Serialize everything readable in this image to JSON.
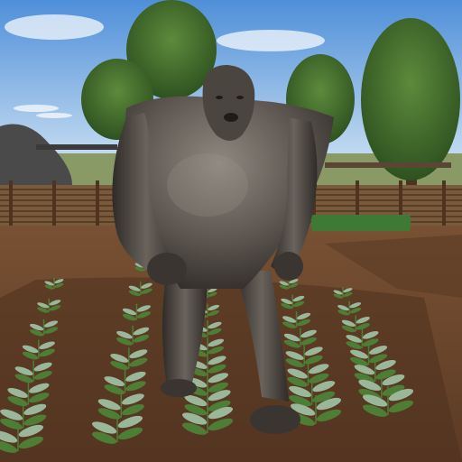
{
  "scene": {
    "description_free": true,
    "colors": {
      "sky_top": "#4f8fd9",
      "sky_bottom": "#cfe3f3",
      "soil": "#6e4a30",
      "soil_dark": "#4e321f",
      "fence": "#7a5a3c",
      "tree": "#3f6b2a",
      "creature": "#5b5550",
      "creature_shadow": "#2e2a27",
      "plant": "#4e7d36",
      "plant_light": "#9bb79a"
    },
    "plants": {
      "rows": 5,
      "per_row": 8
    }
  }
}
